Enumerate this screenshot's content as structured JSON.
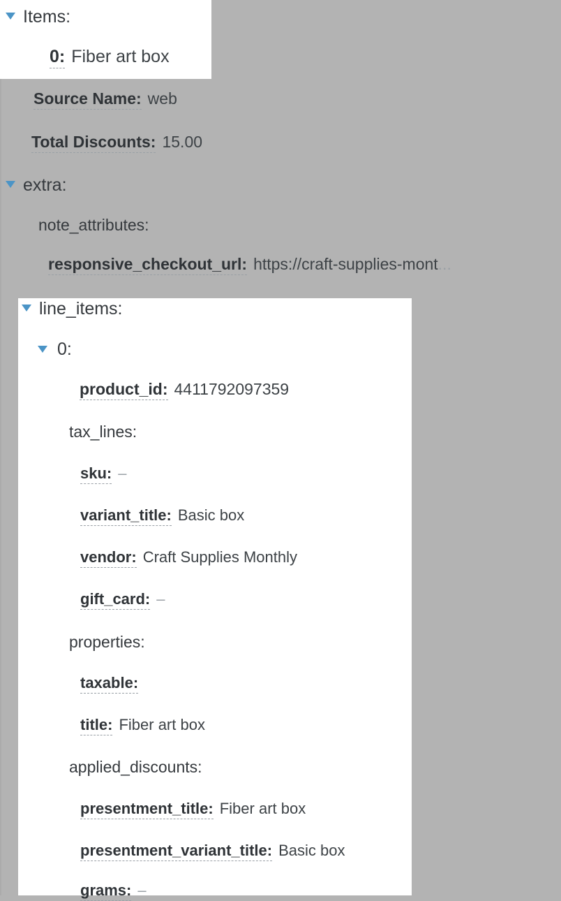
{
  "theme": {
    "background": "#b3b3b3",
    "panel_background": "#ffffff",
    "accent_triangle": "#4b94c6",
    "key_text": "#2f3337",
    "value_text": "#3d4246",
    "muted_text": "#9aa0a6"
  },
  "tree": {
    "items_node": {
      "label": "Items:",
      "children": [
        {
          "key": "0:",
          "value": "Fiber art box"
        }
      ]
    },
    "order_fields": [
      {
        "key": "Source Name:",
        "value": "web"
      },
      {
        "key": "Total Discounts:",
        "value": "15.00"
      }
    ],
    "extra_node": {
      "label": "extra:",
      "note_attributes_label": "note_attributes:",
      "note_attributes": [
        {
          "key": "responsive_checkout_url:",
          "value": "https://craft-supplies-mont",
          "truncated_suffix": "..."
        }
      ]
    },
    "line_items_node": {
      "label": "line_items:",
      "index_label": "0:",
      "fields": [
        {
          "key": "product_id:",
          "value": "4411792097359"
        }
      ],
      "tax_lines_label": "tax_lines:",
      "tax_lines_fields": [
        {
          "key": "sku:",
          "value": "–"
        },
        {
          "key": "variant_title:",
          "value": "Basic box"
        },
        {
          "key": "vendor:",
          "value": "Craft Supplies Monthly"
        },
        {
          "key": "gift_card:",
          "value": "–"
        }
      ],
      "properties_label": "properties:",
      "properties_fields": [
        {
          "key": "taxable:",
          "value": ""
        },
        {
          "key": "title:",
          "value": "Fiber art box"
        }
      ],
      "applied_discounts_label": "applied_discounts:",
      "applied_discounts_fields": [
        {
          "key": "presentment_title:",
          "value": "Fiber art box"
        },
        {
          "key": "presentment_variant_title:",
          "value": "Basic box"
        },
        {
          "key": "grams:",
          "value": "–"
        }
      ]
    }
  },
  "icons": {
    "expanded_triangle": "caret-down-icon"
  }
}
